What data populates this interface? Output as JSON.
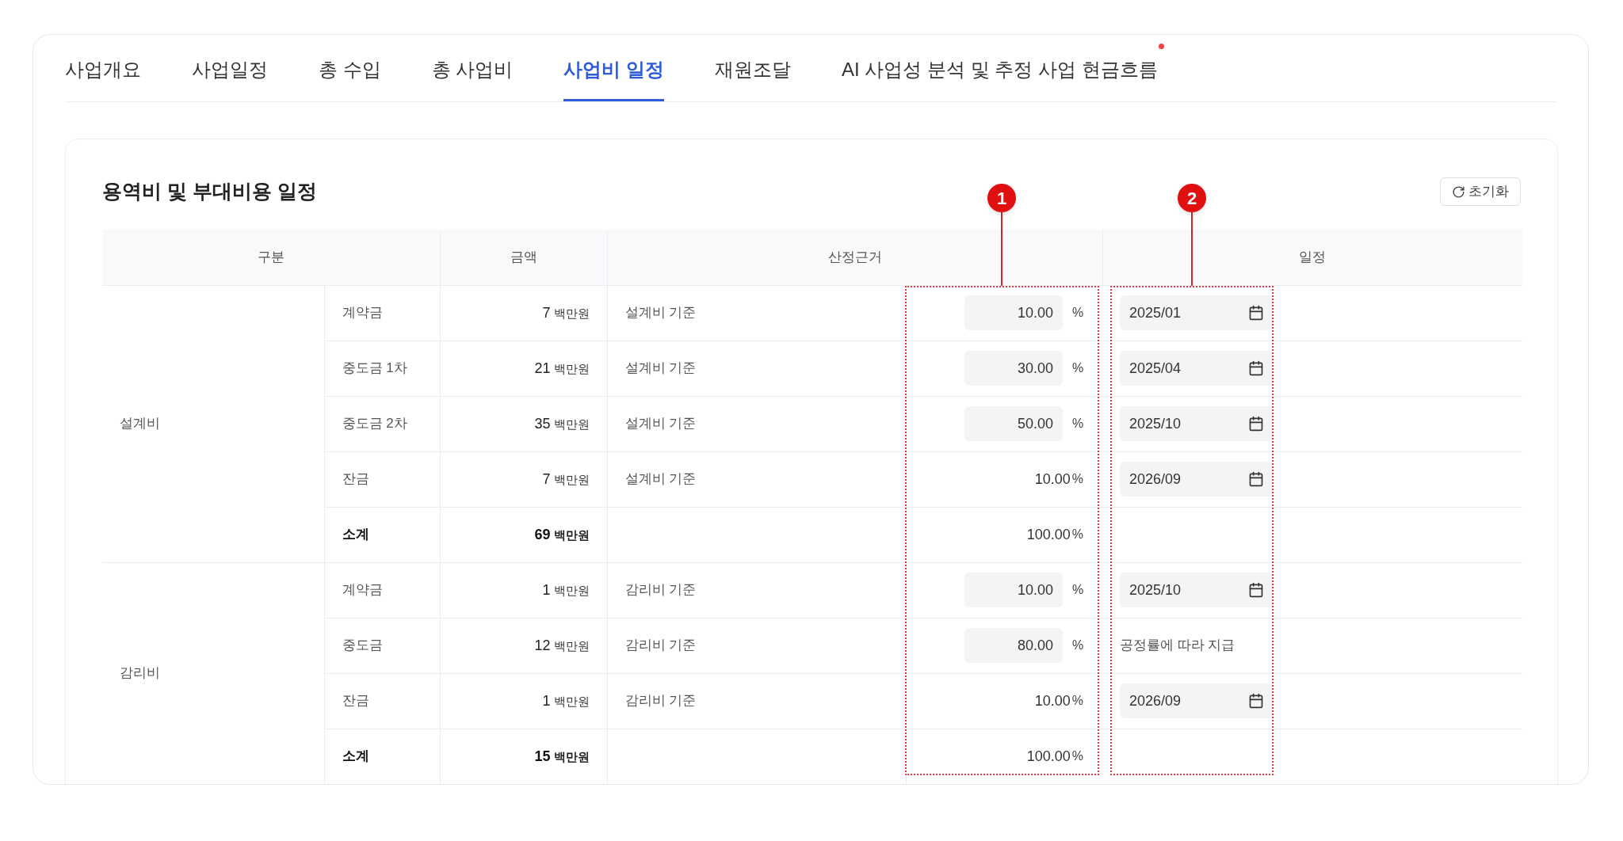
{
  "tabs": [
    {
      "label": "사업개요",
      "selected": false,
      "dot": false
    },
    {
      "label": "사업일정",
      "selected": false,
      "dot": false
    },
    {
      "label": "총 수입",
      "selected": false,
      "dot": false
    },
    {
      "label": "총 사업비",
      "selected": false,
      "dot": false
    },
    {
      "label": "사업비 일정",
      "selected": true,
      "dot": false
    },
    {
      "label": "재원조달",
      "selected": false,
      "dot": false
    },
    {
      "label": "AI 사업성 분석 및 추정 사업 현금흐름",
      "selected": false,
      "dot": true
    }
  ],
  "section": {
    "title": "용역비 및 부대비용 일정",
    "reset_button": "초기화"
  },
  "table": {
    "columns": [
      "구분",
      "금액",
      "산정근거",
      "일정"
    ],
    "groups": [
      {
        "label": "설계비",
        "rows": [
          {
            "item": "계약금",
            "subtotal": false,
            "amount": "7",
            "unit": "백만원",
            "basis": "설계비 기준",
            "percent": "10.00",
            "percent_unit": "%",
            "percent_editable": true,
            "schedule": {
              "kind": "date",
              "value": "2025/01"
            }
          },
          {
            "item": "중도금 1차",
            "subtotal": false,
            "amount": "21",
            "unit": "백만원",
            "basis": "설계비 기준",
            "percent": "30.00",
            "percent_unit": "%",
            "percent_editable": true,
            "schedule": {
              "kind": "date",
              "value": "2025/04"
            }
          },
          {
            "item": "중도금 2차",
            "subtotal": false,
            "amount": "35",
            "unit": "백만원",
            "basis": "설계비 기준",
            "percent": "50.00",
            "percent_unit": "%",
            "percent_editable": true,
            "schedule": {
              "kind": "date",
              "value": "2025/10"
            }
          },
          {
            "item": "잔금",
            "subtotal": false,
            "amount": "7",
            "unit": "백만원",
            "basis": "설계비 기준",
            "percent": "10.00",
            "percent_unit": "%",
            "percent_editable": false,
            "schedule": {
              "kind": "date",
              "value": "2026/09"
            }
          },
          {
            "item": "소계",
            "subtotal": true,
            "amount": "69",
            "unit": "백만원",
            "percent": "100.00",
            "percent_unit": "%",
            "percent_editable": false
          }
        ]
      },
      {
        "label": "감리비",
        "rows": [
          {
            "item": "계약금",
            "subtotal": false,
            "amount": "1",
            "unit": "백만원",
            "basis": "감리비 기준",
            "percent": "10.00",
            "percent_unit": "%",
            "percent_editable": true,
            "schedule": {
              "kind": "date",
              "value": "2025/10"
            }
          },
          {
            "item": "중도금",
            "subtotal": false,
            "amount": "12",
            "unit": "백만원",
            "basis": "감리비 기준",
            "percent": "80.00",
            "percent_unit": "%",
            "percent_editable": true,
            "schedule": {
              "kind": "text",
              "value": "공정률에 따라 지급"
            }
          },
          {
            "item": "잔금",
            "subtotal": false,
            "amount": "1",
            "unit": "백만원",
            "basis": "감리비 기준",
            "percent": "10.00",
            "percent_unit": "%",
            "percent_editable": false,
            "schedule": {
              "kind": "date",
              "value": "2026/09"
            }
          },
          {
            "item": "소계",
            "subtotal": true,
            "amount": "15",
            "unit": "백만원",
            "percent": "100.00",
            "percent_unit": "%",
            "percent_editable": false
          }
        ]
      }
    ]
  },
  "annotations": [
    {
      "label": "1",
      "kind": "percent"
    },
    {
      "label": "2",
      "kind": "schedule"
    }
  ]
}
